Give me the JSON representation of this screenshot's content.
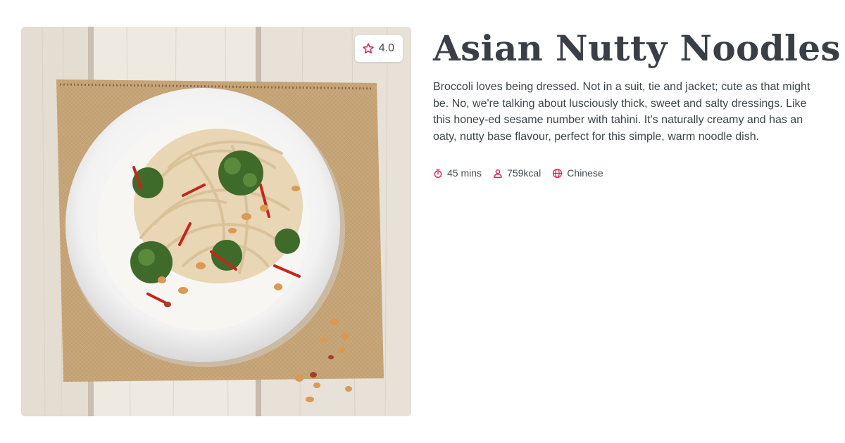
{
  "recipe": {
    "title": "Asian Nutty Noodles",
    "description": "Broccoli loves being dressed. Not in a suit, tie and jacket; cute as that might be. No, we're talking about lusciously thick, sweet and salty dressings. Like this honey-ed sesame number with tahini. It's naturally creamy and has an oaty, nutty base flavour, perfect for this simple, warm noodle dish.",
    "rating": "4.0",
    "rating_icon": "star-outline-icon",
    "meta": {
      "time": "45 mins",
      "time_icon": "timer-icon",
      "calories": "759kcal",
      "calories_icon": "person-icon",
      "cuisine": "Chinese",
      "cuisine_icon": "globe-icon"
    }
  },
  "colors": {
    "accent": "#e0234e",
    "title": "#3a3f47",
    "body_text": "#3f444b"
  }
}
